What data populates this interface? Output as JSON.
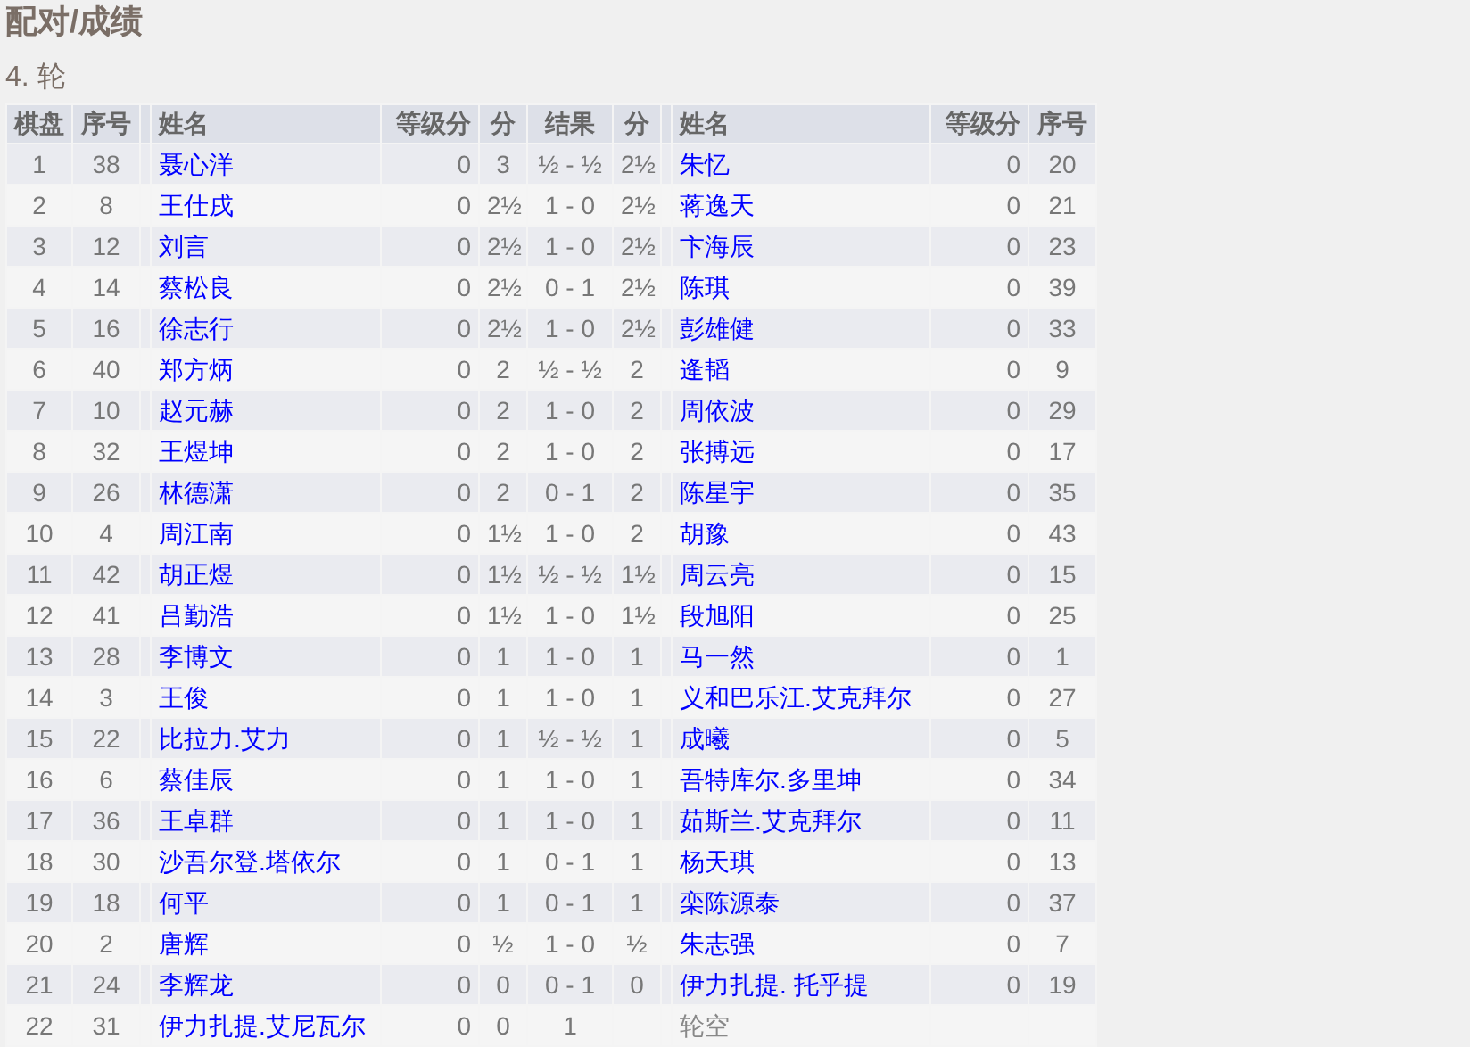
{
  "title": "配对/成绩",
  "round": "4. 轮",
  "columns": {
    "board": "棋盘",
    "no": "序号",
    "name": "姓名",
    "rating": "等级分",
    "points": "分",
    "result": "结果",
    "points2": "分",
    "name2": "姓名",
    "rating2": "等级分",
    "no2": "序号"
  },
  "rows": [
    {
      "board": "1",
      "white": {
        "no": "38",
        "name": "聂心洋",
        "rating": "0",
        "points": "3"
      },
      "result": "½ - ½",
      "black": {
        "kind": "player",
        "points": "2½",
        "name": "朱忆",
        "rating": "0",
        "no": "20"
      }
    },
    {
      "board": "2",
      "white": {
        "no": "8",
        "name": "王仕戌",
        "rating": "0",
        "points": "2½"
      },
      "result": "1 - 0",
      "black": {
        "kind": "player",
        "points": "2½",
        "name": "蒋逸天",
        "rating": "0",
        "no": "21"
      }
    },
    {
      "board": "3",
      "white": {
        "no": "12",
        "name": "刘言",
        "rating": "0",
        "points": "2½"
      },
      "result": "1 - 0",
      "black": {
        "kind": "player",
        "points": "2½",
        "name": "卞海辰",
        "rating": "0",
        "no": "23"
      }
    },
    {
      "board": "4",
      "white": {
        "no": "14",
        "name": "蔡松良",
        "rating": "0",
        "points": "2½"
      },
      "result": "0 - 1",
      "black": {
        "kind": "player",
        "points": "2½",
        "name": "陈琪",
        "rating": "0",
        "no": "39"
      }
    },
    {
      "board": "5",
      "white": {
        "no": "16",
        "name": "徐志行",
        "rating": "0",
        "points": "2½"
      },
      "result": "1 - 0",
      "black": {
        "kind": "player",
        "points": "2½",
        "name": "彭雄健",
        "rating": "0",
        "no": "33"
      }
    },
    {
      "board": "6",
      "white": {
        "no": "40",
        "name": "郑方炳",
        "rating": "0",
        "points": "2"
      },
      "result": "½ - ½",
      "black": {
        "kind": "player",
        "points": "2",
        "name": "逄韬",
        "rating": "0",
        "no": "9"
      }
    },
    {
      "board": "7",
      "white": {
        "no": "10",
        "name": "赵元赫",
        "rating": "0",
        "points": "2"
      },
      "result": "1 - 0",
      "black": {
        "kind": "player",
        "points": "2",
        "name": "周依波",
        "rating": "0",
        "no": "29"
      }
    },
    {
      "board": "8",
      "white": {
        "no": "32",
        "name": "王煜坤",
        "rating": "0",
        "points": "2"
      },
      "result": "1 - 0",
      "black": {
        "kind": "player",
        "points": "2",
        "name": "张搏远",
        "rating": "0",
        "no": "17"
      }
    },
    {
      "board": "9",
      "white": {
        "no": "26",
        "name": "林德潇",
        "rating": "0",
        "points": "2"
      },
      "result": "0 - 1",
      "black": {
        "kind": "player",
        "points": "2",
        "name": "陈星宇",
        "rating": "0",
        "no": "35"
      }
    },
    {
      "board": "10",
      "white": {
        "no": "4",
        "name": "周江南",
        "rating": "0",
        "points": "1½"
      },
      "result": "1 - 0",
      "black": {
        "kind": "player",
        "points": "2",
        "name": "胡豫",
        "rating": "0",
        "no": "43"
      }
    },
    {
      "board": "11",
      "white": {
        "no": "42",
        "name": "胡正煜",
        "rating": "0",
        "points": "1½"
      },
      "result": "½ - ½",
      "black": {
        "kind": "player",
        "points": "1½",
        "name": "周云亮",
        "rating": "0",
        "no": "15"
      }
    },
    {
      "board": "12",
      "white": {
        "no": "41",
        "name": "吕勤浩",
        "rating": "0",
        "points": "1½"
      },
      "result": "1 - 0",
      "black": {
        "kind": "player",
        "points": "1½",
        "name": "段旭阳",
        "rating": "0",
        "no": "25"
      }
    },
    {
      "board": "13",
      "white": {
        "no": "28",
        "name": "李博文",
        "rating": "0",
        "points": "1"
      },
      "result": "1 - 0",
      "black": {
        "kind": "player",
        "points": "1",
        "name": "马一然",
        "rating": "0",
        "no": "1"
      }
    },
    {
      "board": "14",
      "white": {
        "no": "3",
        "name": "王俊",
        "rating": "0",
        "points": "1"
      },
      "result": "1 - 0",
      "black": {
        "kind": "player",
        "points": "1",
        "name": "义和巴乐江.艾克拜尔",
        "rating": "0",
        "no": "27"
      }
    },
    {
      "board": "15",
      "white": {
        "no": "22",
        "name": "比拉力.艾力",
        "rating": "0",
        "points": "1"
      },
      "result": "½ - ½",
      "black": {
        "kind": "player",
        "points": "1",
        "name": "成曦",
        "rating": "0",
        "no": "5"
      }
    },
    {
      "board": "16",
      "white": {
        "no": "6",
        "name": "蔡佳辰",
        "rating": "0",
        "points": "1"
      },
      "result": "1 - 0",
      "black": {
        "kind": "player",
        "points": "1",
        "name": "吾特库尔.多里坤",
        "rating": "0",
        "no": "34"
      }
    },
    {
      "board": "17",
      "white": {
        "no": "36",
        "name": "王卓群",
        "rating": "0",
        "points": "1"
      },
      "result": "1 - 0",
      "black": {
        "kind": "player",
        "points": "1",
        "name": "茹斯兰.艾克拜尔",
        "rating": "0",
        "no": "11"
      }
    },
    {
      "board": "18",
      "white": {
        "no": "30",
        "name": "沙吾尔登.塔依尔",
        "rating": "0",
        "points": "1"
      },
      "result": "0 - 1",
      "black": {
        "kind": "player",
        "points": "1",
        "name": "杨天琪",
        "rating": "0",
        "no": "13"
      }
    },
    {
      "board": "19",
      "white": {
        "no": "18",
        "name": "何平",
        "rating": "0",
        "points": "1"
      },
      "result": "0 - 1",
      "black": {
        "kind": "player",
        "points": "1",
        "name": "栾陈源泰",
        "rating": "0",
        "no": "37"
      }
    },
    {
      "board": "20",
      "white": {
        "no": "2",
        "name": "唐辉",
        "rating": "0",
        "points": "½"
      },
      "result": "1 - 0",
      "black": {
        "kind": "player",
        "points": "½",
        "name": "朱志强",
        "rating": "0",
        "no": "7"
      }
    },
    {
      "board": "21",
      "white": {
        "no": "24",
        "name": "李辉龙",
        "rating": "0",
        "points": "0"
      },
      "result": "0 - 1",
      "black": {
        "kind": "player",
        "points": "0",
        "name": "伊力扎提. 托乎提",
        "rating": "0",
        "no": "19"
      }
    },
    {
      "board": "22",
      "white": {
        "no": "31",
        "name": "伊力扎提.艾尼瓦尔",
        "rating": "0",
        "points": "0"
      },
      "result": "1",
      "black": {
        "kind": "bye",
        "name": "轮空"
      }
    }
  ]
}
